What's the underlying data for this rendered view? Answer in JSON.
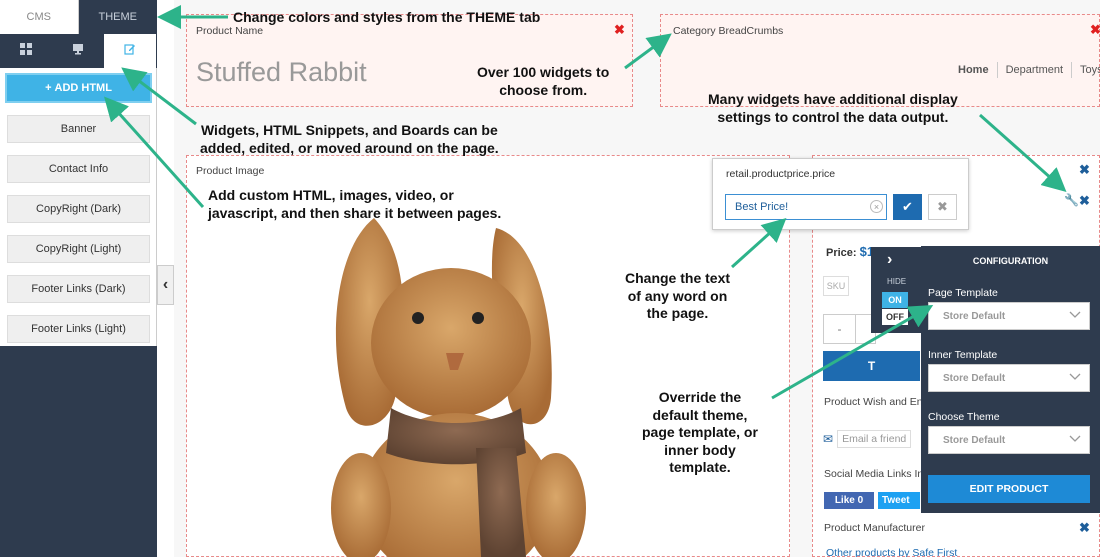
{
  "sidebar": {
    "tabs": [
      {
        "label": "CMS"
      },
      {
        "label": "THEME"
      }
    ],
    "icons": [
      "widgets-grid-icon",
      "boards-icon",
      "edit-snippet-icon"
    ],
    "add_html_label": "ADD HTML",
    "add_html_plus": "+",
    "items": [
      {
        "label": "Banner"
      },
      {
        "label": "Contact Info"
      },
      {
        "label": "CopyRight (Dark)"
      },
      {
        "label": "CopyRight (Light)"
      },
      {
        "label": "Footer Links (Dark)"
      },
      {
        "label": "Footer Links (Light)"
      }
    ],
    "collapse_glyph": "‹"
  },
  "page": {
    "product_name_label": "Product Name",
    "product_title": "Stuffed Rabbit",
    "breadcrumbs_label": "Category BreadCrumbs",
    "breadcrumbs": [
      "Home",
      "Department",
      "Toys"
    ],
    "product_image_label": "Product Image",
    "close_glyph": "✖"
  },
  "editor": {
    "key": "retail.productprice.price",
    "value": "Best Price!",
    "clear_glyph": "×",
    "ok_glyph": "✔",
    "cancel_glyph": "✖"
  },
  "product": {
    "price_label": "Price:",
    "price_value": "$1",
    "sku_label": "SKU",
    "qty_minus": "-",
    "add_cart_text": "T",
    "wish_label": "Product Wish and En",
    "email_friend": "Email a friend",
    "social_label": "Social Media Links In",
    "like_label": "Like 0",
    "tweet_label": "Tweet",
    "manufacturer_label": "Product Manufacturer",
    "manufacturer_link": "Other products by  Safe First"
  },
  "hide_control": {
    "label": "HIDE",
    "on": "ON",
    "off": "OFF",
    "arrow": "›"
  },
  "config": {
    "title": "CONFIGURATION",
    "fields": [
      {
        "label": "Page Template",
        "value": "Store Default"
      },
      {
        "label": "Inner Template",
        "value": "Store Default"
      },
      {
        "label": "Choose Theme",
        "value": "Store Default"
      }
    ],
    "edit_button": "EDIT PRODUCT"
  },
  "annotations": {
    "theme_tab": "Change colors and styles from the THEME tab",
    "widgets_count": [
      "Over 100 widgets to",
      "choose from."
    ],
    "display_settings": [
      "Many widgets have additional display",
      "settings to control the data output."
    ],
    "widgets_snippets": [
      "Widgets, HTML Snippets, and Boards can be",
      "added, edited, or moved around on the page."
    ],
    "custom_html": [
      "Add custom HTML, images, video, or",
      "javascript, and then share it between pages."
    ],
    "change_text": [
      "Change the text",
      "of any word on",
      "the page."
    ],
    "override": [
      "Override the",
      "default theme,",
      "page template, or",
      "inner body",
      "template."
    ]
  },
  "colors": {
    "sidebar_bg": "#2e3b4e",
    "accent_blue": "#3fb3e6",
    "button_blue": "#1e6bb0",
    "annotation_arrow": "#2db38a",
    "widget_box_border": "#e88a8a"
  }
}
